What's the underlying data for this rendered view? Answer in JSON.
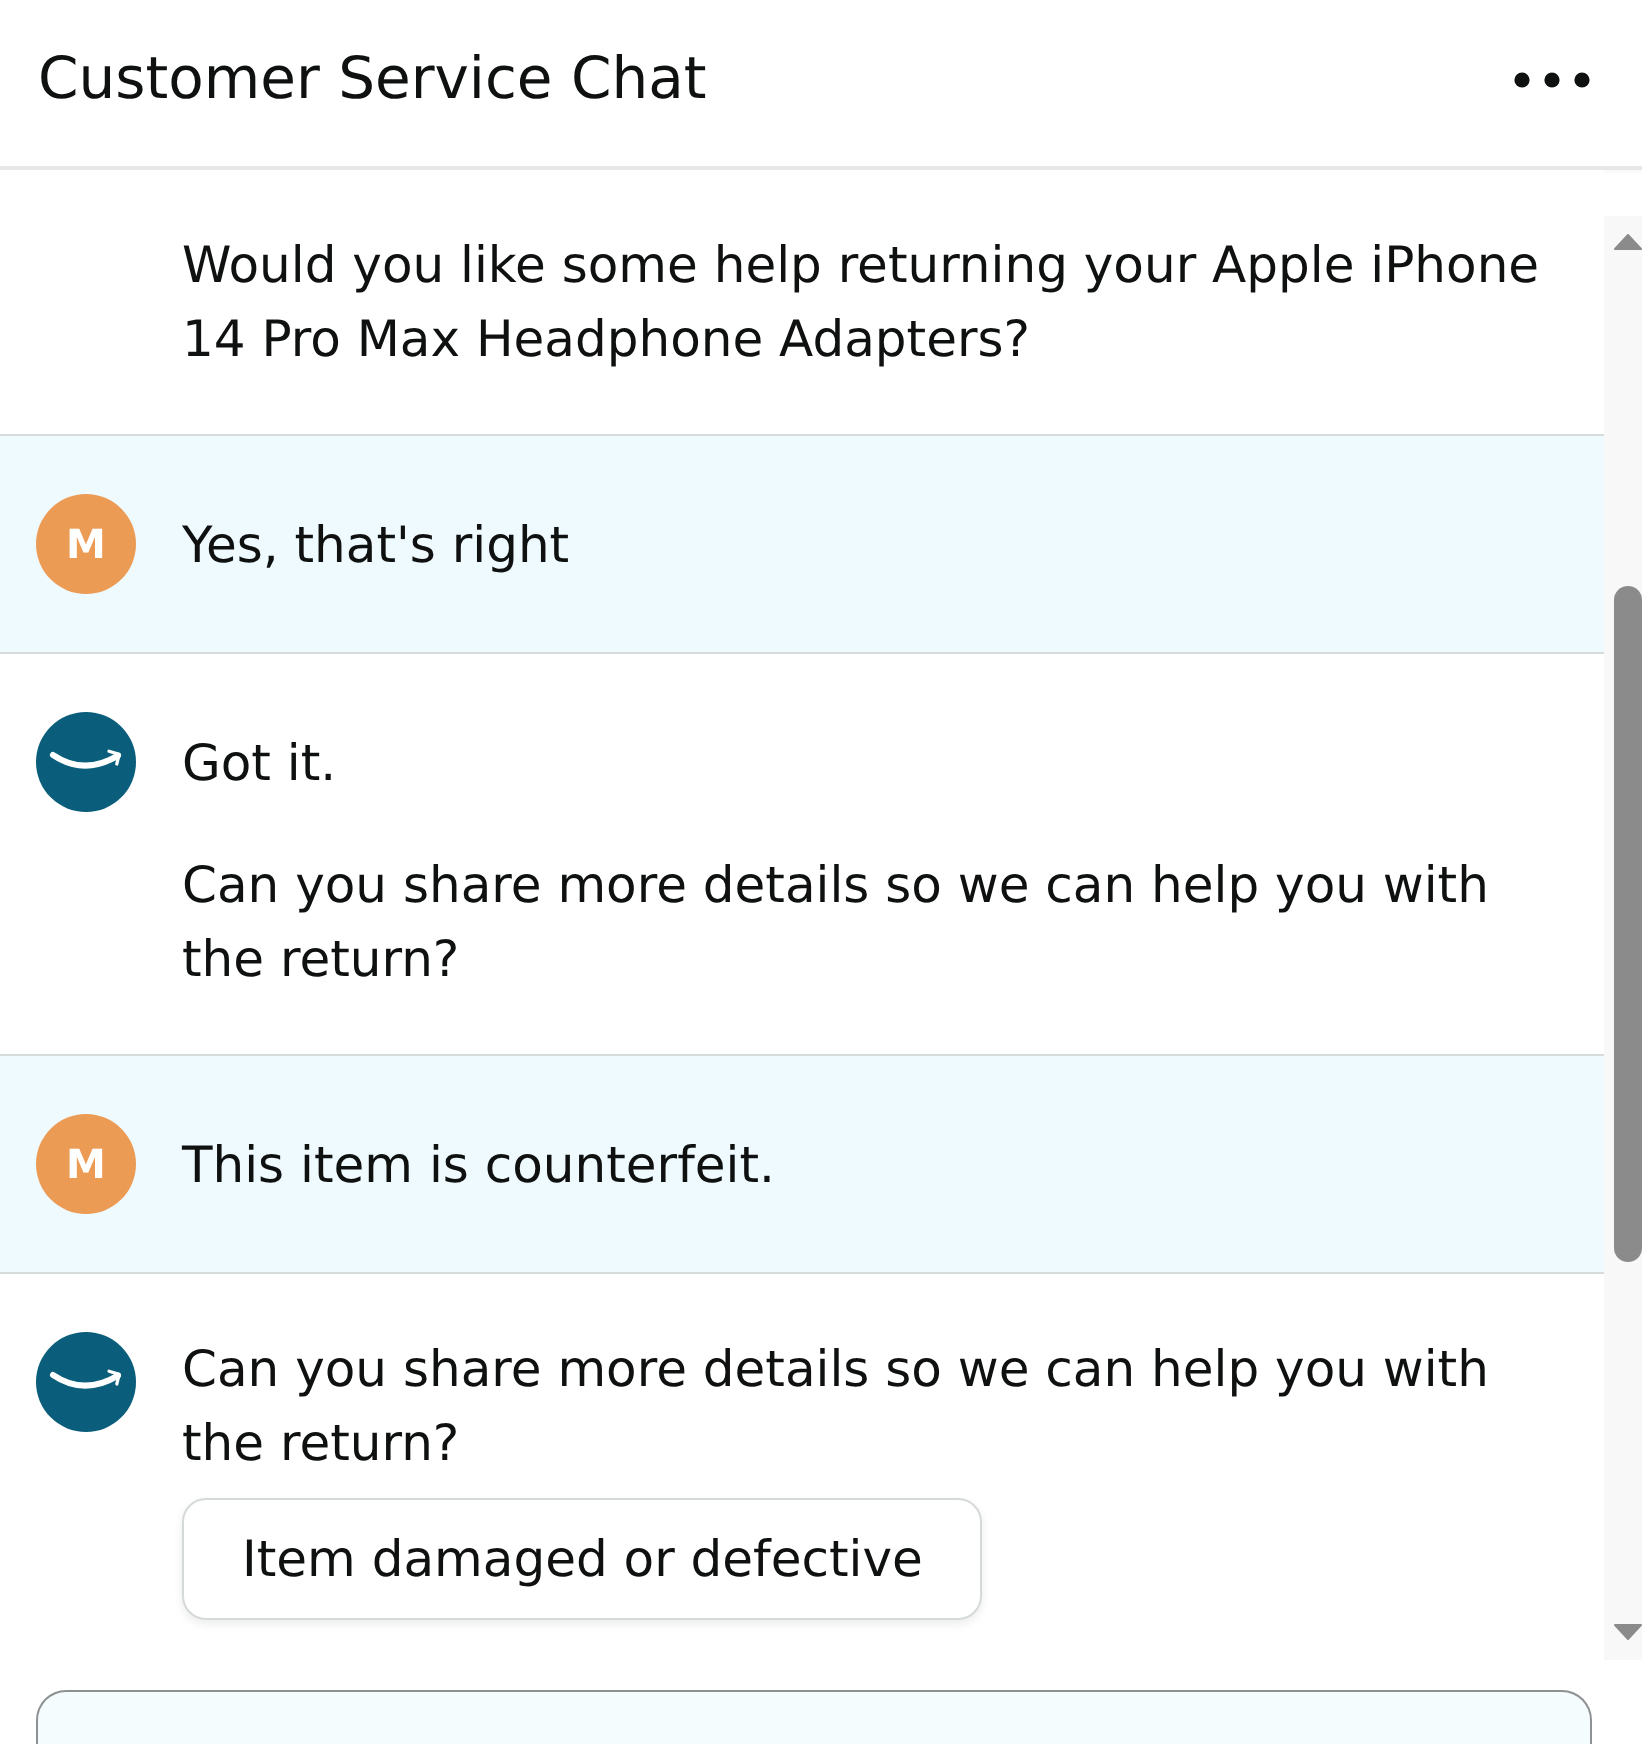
{
  "header": {
    "title": "Customer Service Chat"
  },
  "messages": [
    {
      "kind": "agent",
      "continued": true,
      "paragraphs": [
        "Would you like some help returning your Apple iPhone 14 Pro Max Headphone Adapters?"
      ]
    },
    {
      "kind": "customer",
      "continued": false,
      "avatar_initial": "M",
      "paragraphs": [
        "Yes, that's right"
      ]
    },
    {
      "kind": "agent",
      "continued": false,
      "paragraphs": [
        "Got it.",
        "Can you share more details so we can help you with the return?"
      ]
    },
    {
      "kind": "customer",
      "continued": false,
      "avatar_initial": "M",
      "paragraphs": [
        "This item is counterfeit."
      ]
    },
    {
      "kind": "agent",
      "continued": false,
      "paragraphs": [
        "Can you share more details so we can help you with the return?"
      ],
      "options": [
        "Item damaged or defective"
      ]
    }
  ]
}
